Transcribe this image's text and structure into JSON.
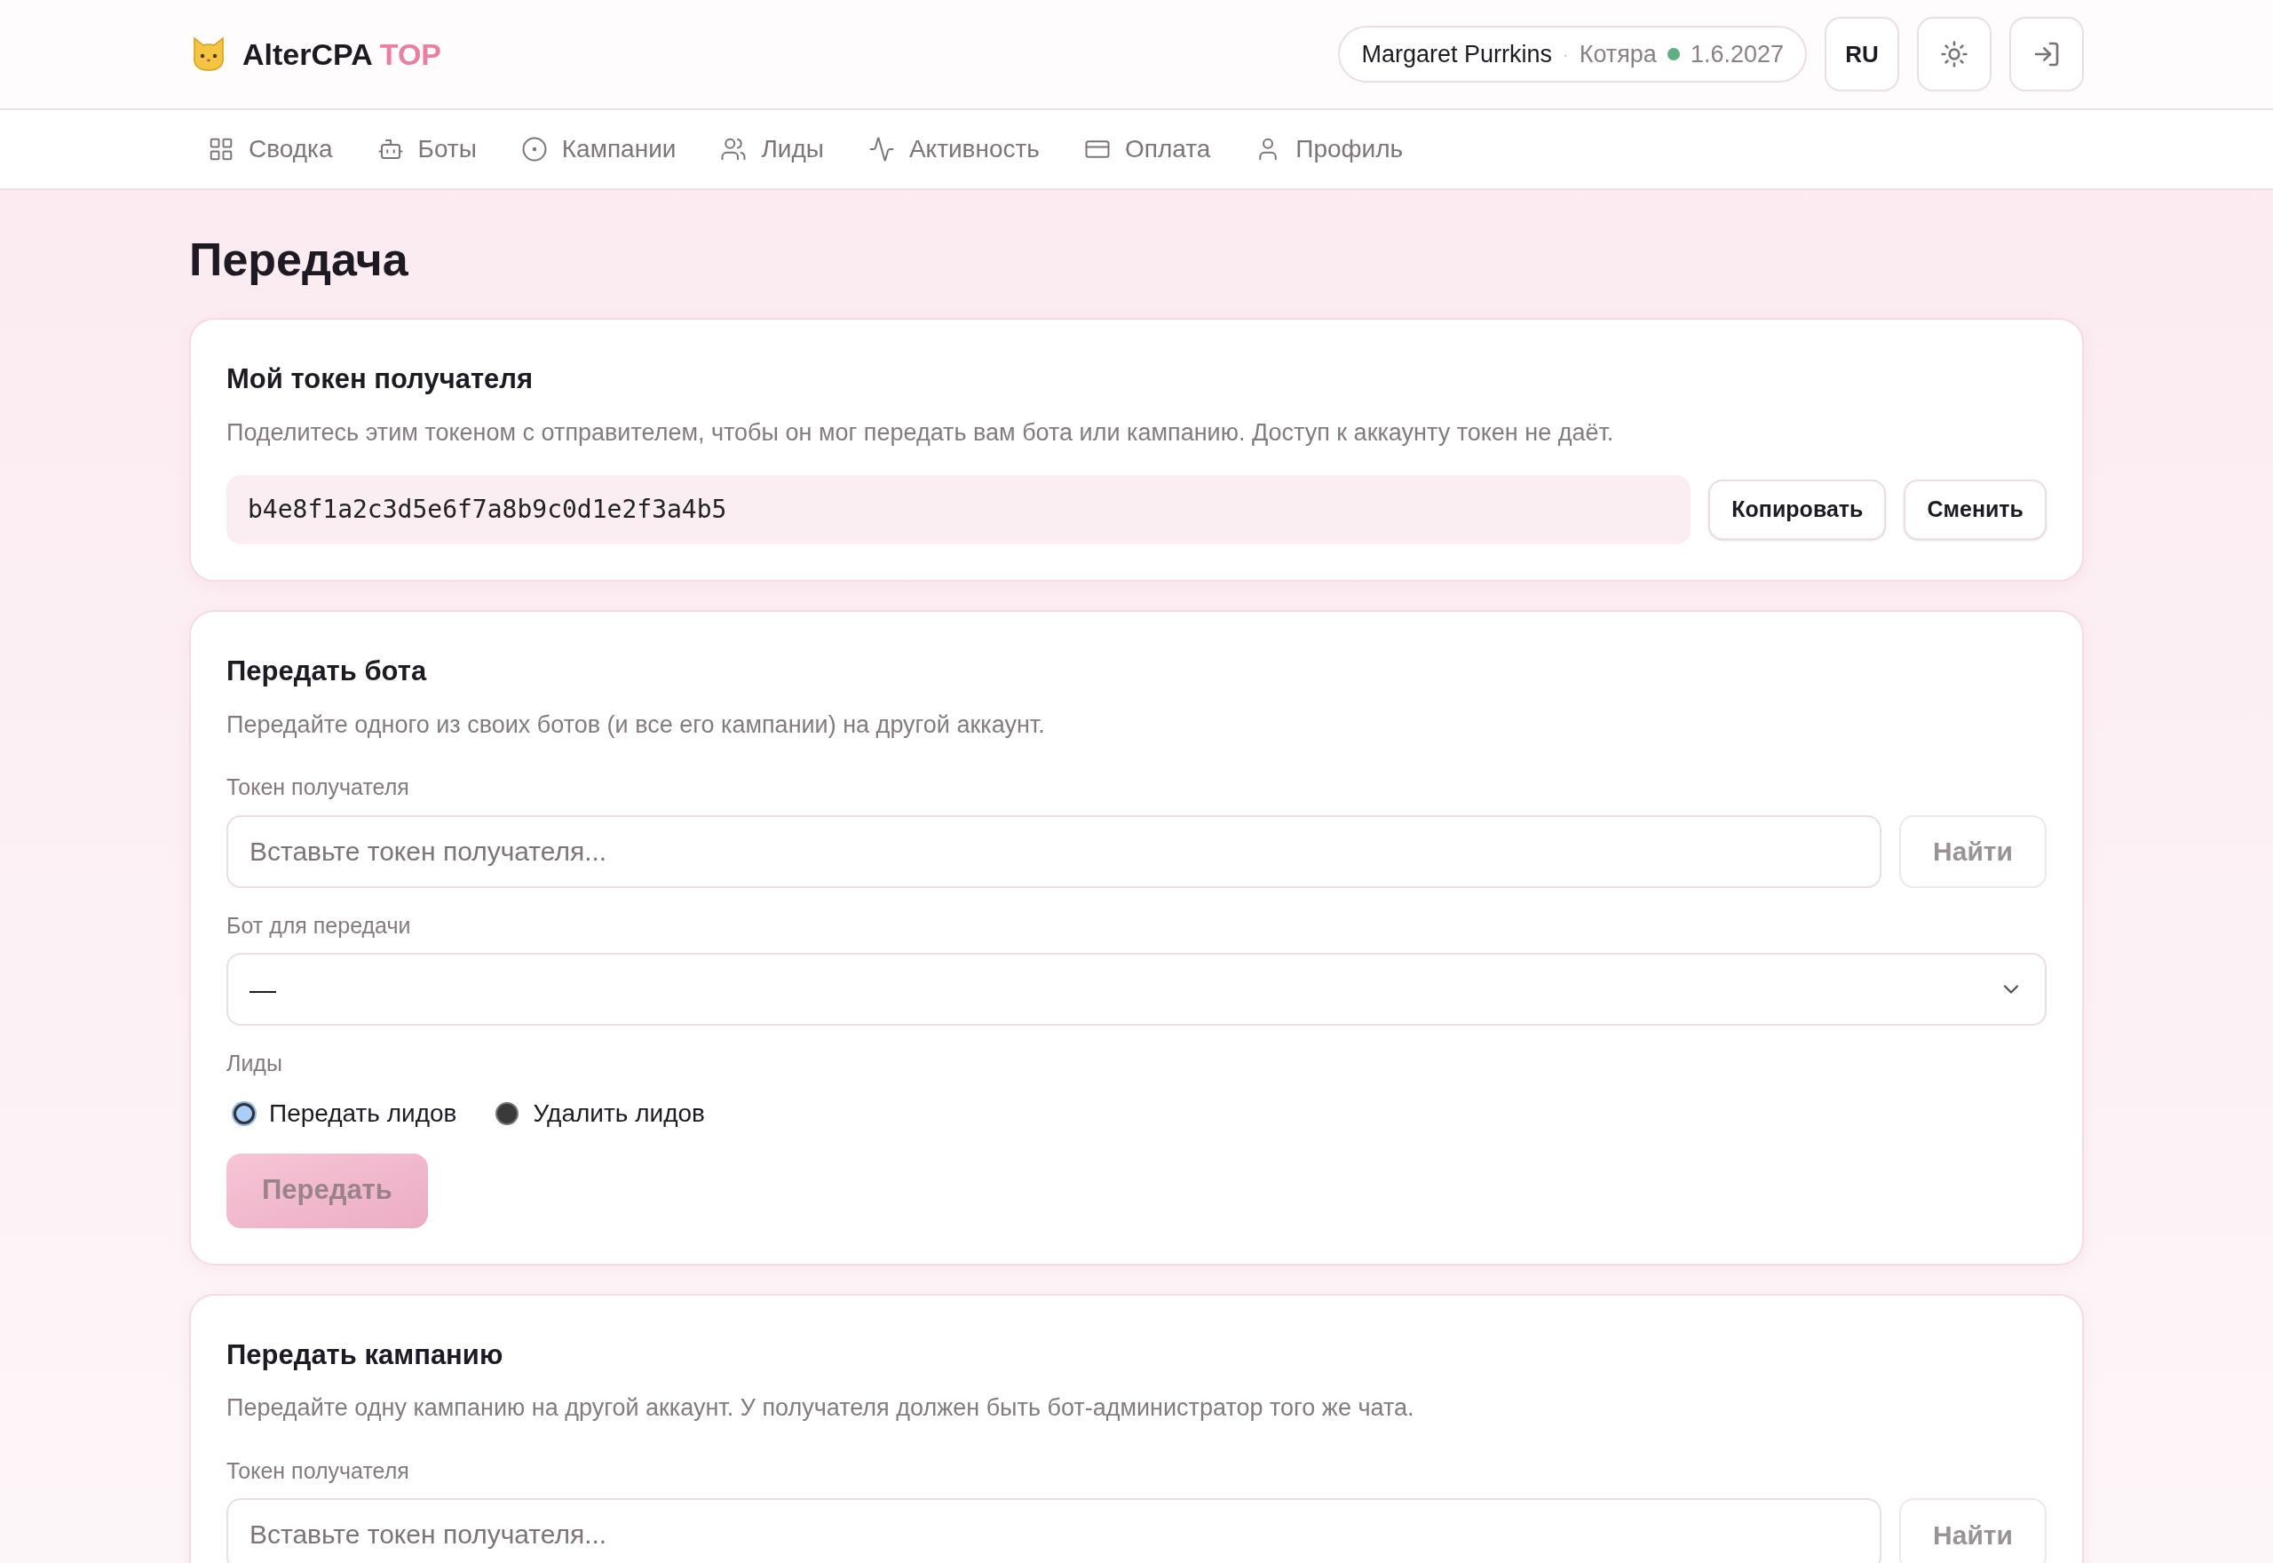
{
  "header": {
    "brand": "AlterCPA",
    "brand_accent": "TOP",
    "user": {
      "name": "Margaret Purrkins",
      "separator": "·",
      "plan": "Котяра",
      "date": "1.6.2027"
    },
    "language": "RU"
  },
  "nav": [
    {
      "kind": "grid",
      "label": "Сводка"
    },
    {
      "kind": "bot",
      "label": "Боты"
    },
    {
      "kind": "target",
      "label": "Кампании"
    },
    {
      "kind": "users",
      "label": "Лиды"
    },
    {
      "kind": "activity",
      "label": "Активность"
    },
    {
      "kind": "card",
      "label": "Оплата"
    },
    {
      "kind": "user",
      "label": "Профиль"
    }
  ],
  "page_title": "Передача",
  "my_token": {
    "title": "Мой токен получателя",
    "description": "Поделитесь этим токеном с отправителем, чтобы он мог передать вам бота или кампанию. Доступ к аккаунту токен не даёт.",
    "token": "b4e8f1a2c3d5e6f7a8b9c0d1e2f3a4b5",
    "buttons": [
      "Копировать",
      "Сменить"
    ]
  },
  "transfer_bot": {
    "title": "Передать бота",
    "description": "Передайте одного из своих ботов (и все его кампании) на другой аккаунт.",
    "token_label": "Токен получателя",
    "token_placeholder": "Вставьте токен получателя...",
    "find_button": "Найти",
    "bot_label": "Бот для передачи",
    "bot_value": "—",
    "leads_label": "Лиды",
    "leads_options": [
      {
        "label": "Передать лидов",
        "selected": true
      },
      {
        "label": "Удалить лидов",
        "selected": false
      }
    ],
    "submit": "Передать",
    "submit_disabled": true
  },
  "transfer_campaign": {
    "title": "Передать кампанию",
    "description": "Передайте одну кампанию на другой аккаунт. У получателя должен быть бот-администратор того же чата.",
    "token_label": "Токен получателя",
    "token_placeholder": "Вставьте токен получателя...",
    "find_button": "Найти"
  }
}
